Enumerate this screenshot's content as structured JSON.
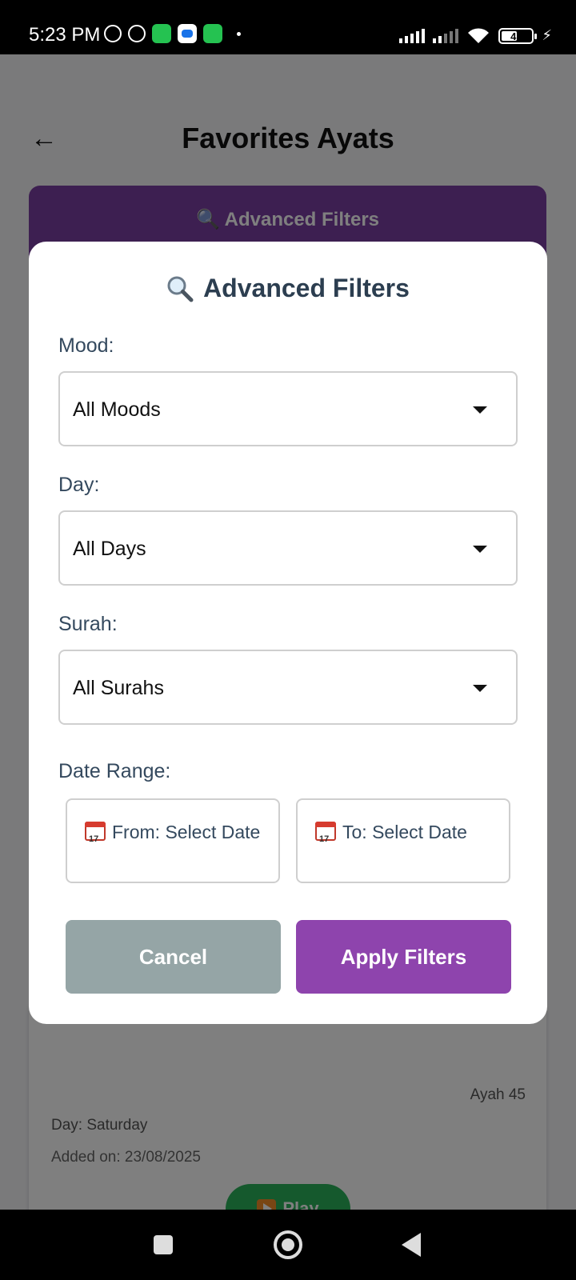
{
  "status_bar": {
    "time": "5:23 PM",
    "battery": "47",
    "icons": [
      "mute-icon",
      "alarm-icon",
      "whatsapp-icon",
      "message-icon",
      "chat-icon",
      "signal-icon",
      "wifi-icon",
      "battery-icon",
      "charging-icon"
    ]
  },
  "header": {
    "back_glyph": "←",
    "title": "Favorites Ayats"
  },
  "filters_bar": {
    "label": "🔍 Advanced Filters"
  },
  "card": {
    "ayah": "Ayah 45",
    "day": "Day: Saturday",
    "added": "Added on: 23/08/2025",
    "play_label": "Play"
  },
  "modal": {
    "title": "Advanced Filters",
    "mood": {
      "label": "Mood:",
      "value": "All Moods"
    },
    "day": {
      "label": "Day:",
      "value": "All Days"
    },
    "surah": {
      "label": "Surah:",
      "value": "All Surahs"
    },
    "date_range": {
      "label": "Date Range:",
      "from": "From: Select Date",
      "to": "To: Select Date"
    },
    "cancel_label": "Cancel",
    "apply_label": "Apply Filters"
  },
  "colors": {
    "primary_purple": "#8e44ad",
    "cancel_gray": "#95a5a6",
    "label_text": "#34495e",
    "play_green": "#2ab35b"
  }
}
